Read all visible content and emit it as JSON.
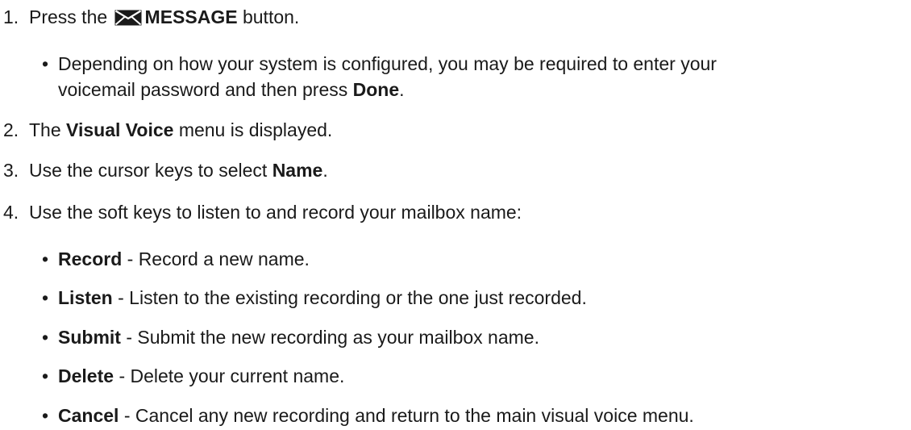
{
  "steps": [
    {
      "number": "1.",
      "prefix": "Press the",
      "button_icon": "envelope-icon",
      "button_label": "MESSAGE",
      "suffix": "button.",
      "notes": [
        {
          "line1": "Depending on how your system is configured, you may be required to enter your",
          "line2_prefix": "voicemail password and then press",
          "line2_bold": "Done",
          "line2_suffix": "."
        }
      ]
    },
    {
      "number": "2.",
      "prefix": "The",
      "bold": "Visual Voice",
      "suffix": "menu is displayed."
    },
    {
      "number": "3.",
      "prefix": "Use the cursor keys to select",
      "bold": "Name",
      "suffix": "."
    },
    {
      "number": "4.",
      "text": "Use the soft keys to listen to and record your mailbox name:",
      "options": [
        {
          "key": "Record",
          "description": "- Record a new name."
        },
        {
          "key": "Listen",
          "description": "- Listen to the existing recording or the one just recorded."
        },
        {
          "key": "Submit",
          "description": "- Submit the new recording as your mailbox name."
        },
        {
          "key": "Delete",
          "description": "- Delete your current name."
        },
        {
          "key": "Cancel",
          "description": "- Cancel any new recording and return to the main visual voice menu."
        }
      ]
    }
  ],
  "bullet_char": "•"
}
